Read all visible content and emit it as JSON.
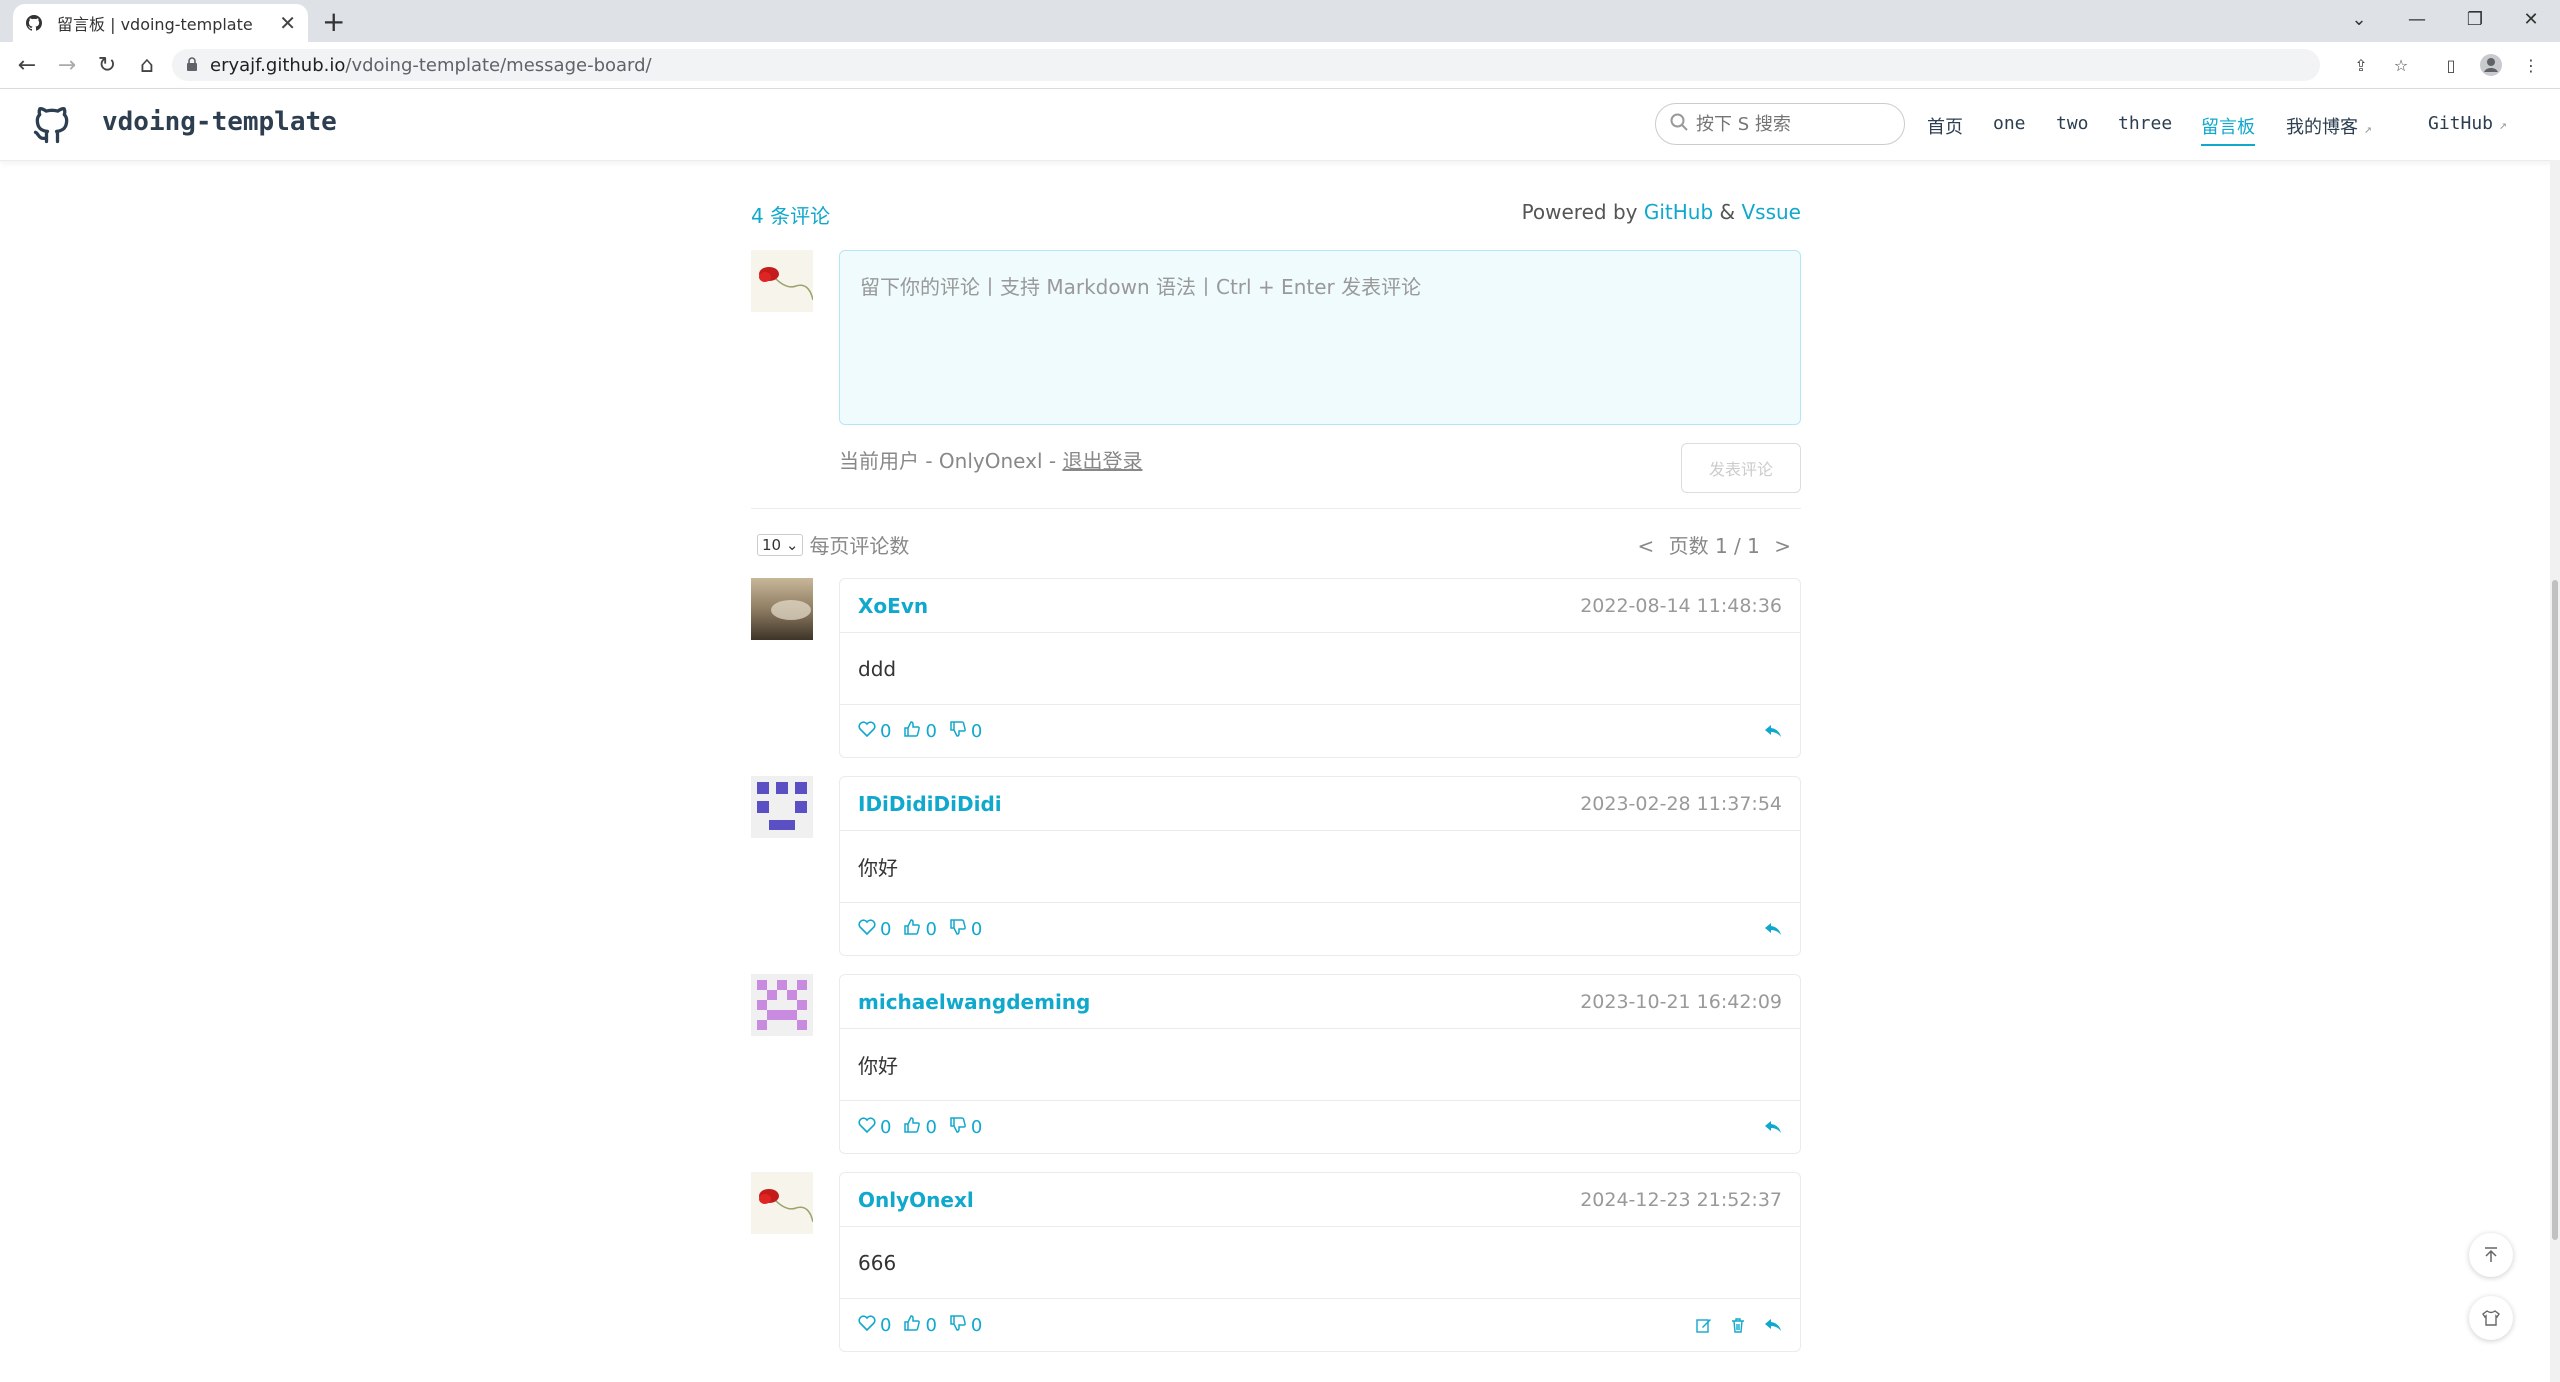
{
  "browser": {
    "tab_title": "留言板 | vdoing-template",
    "url_host": "eryajf.github.io",
    "url_path": "/vdoing-template/message-board/"
  },
  "site": {
    "name": "vdoing-template",
    "search_placeholder": "按下 S 搜索",
    "nav": {
      "home": "首页",
      "one": "one",
      "two": "two",
      "three": "three",
      "board": "留言板",
      "blog": "我的博客",
      "github": "GitHub"
    }
  },
  "vssue": {
    "count_label": "4 条评论",
    "powered_prefix": "Powered by",
    "powered_github": "GitHub",
    "powered_amp": "&",
    "powered_vssue": "Vssue",
    "editor_placeholder": "留下你的评论丨支持 Markdown 语法丨Ctrl + Enter 发表评论",
    "current_user_prefix": "当前用户 - OnlyOnexl -",
    "logout": "退出登录",
    "submit": "发表评论",
    "per_page_value": "10",
    "per_page_label": "每页评论数",
    "pager_prev": "<",
    "pager_text": "页数 1 / 1",
    "pager_next": ">"
  },
  "comments": [
    {
      "author": "XoEvn",
      "date": "2022-08-14 11:48:36",
      "body": "ddd",
      "hearts": "0",
      "likes": "0",
      "dislikes": "0",
      "own": false
    },
    {
      "author": "IDiDidiDiDidi",
      "date": "2023-02-28 11:37:54",
      "body": "你好",
      "hearts": "0",
      "likes": "0",
      "dislikes": "0",
      "own": false
    },
    {
      "author": "michaelwangdeming",
      "date": "2023-10-21 16:42:09",
      "body": "你好",
      "hearts": "0",
      "likes": "0",
      "dislikes": "0",
      "own": false
    },
    {
      "author": "OnlyOnexl",
      "date": "2024-12-23 21:52:37",
      "body": "666",
      "hearts": "0",
      "likes": "0",
      "dislikes": "0",
      "own": true
    }
  ],
  "colors": {
    "accent": "#11a8cd",
    "editor_bg": "#f0fbfd"
  }
}
